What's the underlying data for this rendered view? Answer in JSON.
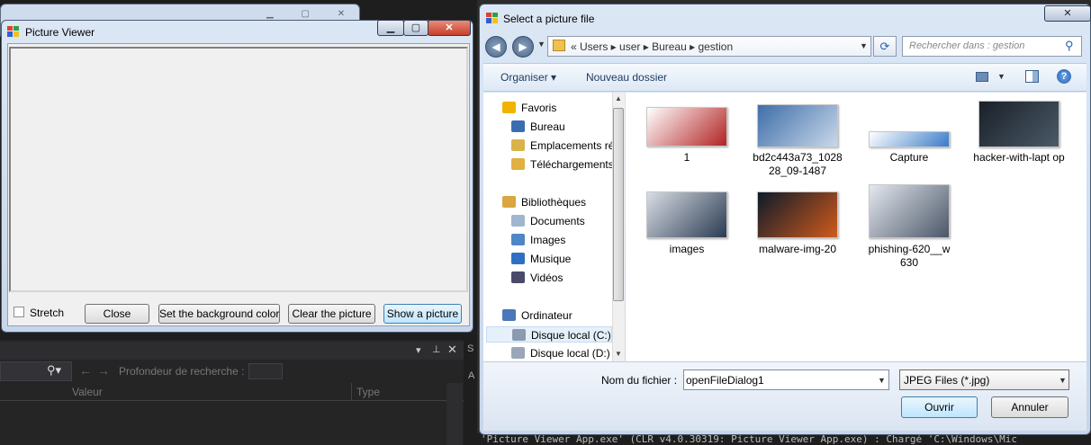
{
  "ide": {
    "depth_label": "Profondeur de recherche :",
    "col_valeur": "Valeur",
    "col_type": "Type",
    "side_tab_s": "S",
    "side_tab_a": "A",
    "output_line": "'Picture Viewer App.exe' (CLR v4.0.30319: Picture Viewer App.exe) : Chargé 'C:\\Windows\\Mic"
  },
  "picture_viewer": {
    "title": "Picture Viewer",
    "stretch_label": "Stretch",
    "stretch_checked": false,
    "buttons": {
      "close": "Close",
      "background": "Set the background color",
      "clear": "Clear the picture",
      "show": "Show a picture"
    }
  },
  "dialog": {
    "title": "Select a picture file",
    "address_path": "«  Users  ▸  user  ▸  Bureau  ▸  gestion",
    "search_placeholder": "Rechercher dans : gestion",
    "toolbar": {
      "organize": "Organiser ▾",
      "new_folder": "Nouveau dossier"
    },
    "nav_items": [
      {
        "label": "Favoris",
        "icon": "star-icon",
        "color": "#f0b400"
      },
      {
        "label": "Bureau",
        "icon": "desktop-icon",
        "color": "#3a6db0"
      },
      {
        "label": "Emplacements ré",
        "icon": "recent-places-icon",
        "color": "#d9b24a"
      },
      {
        "label": "Téléchargements",
        "icon": "downloads-icon",
        "color": "#e0b040"
      },
      {
        "label": "Bibliothèques",
        "icon": "libraries-icon",
        "color": "#d9a640"
      },
      {
        "label": "Documents",
        "icon": "documents-icon",
        "color": "#9fb5d0"
      },
      {
        "label": "Images",
        "icon": "images-icon",
        "color": "#4f86c6"
      },
      {
        "label": "Musique",
        "icon": "music-icon",
        "color": "#2e6fc4"
      },
      {
        "label": "Vidéos",
        "icon": "videos-icon",
        "color": "#4a4a6a"
      },
      {
        "label": "Ordinateur",
        "icon": "computer-icon",
        "color": "#4a78b8"
      },
      {
        "label": "Disque local (C:)",
        "icon": "drive-icon",
        "color": "#8a9bb0"
      },
      {
        "label": "Disque local (D:)",
        "icon": "drive-icon",
        "color": "#9aa7b7"
      }
    ],
    "files": [
      {
        "label": "1",
        "colors": [
          "#ffffff",
          "#b22222"
        ]
      },
      {
        "label": "bd2c443a73_1028 28_09-1487",
        "colors": [
          "#3e6ea8",
          "#c9d8ea"
        ]
      },
      {
        "label": "Capture",
        "colors": [
          "#ffffff",
          "#3a7bc8"
        ]
      },
      {
        "label": "hacker-with-lapt op",
        "colors": [
          "#1a2028",
          "#4a5a68"
        ]
      },
      {
        "label": "images",
        "colors": [
          "#d8dde4",
          "#2a3b52"
        ]
      },
      {
        "label": "malware-img-20",
        "colors": [
          "#0d1a2a",
          "#d05a1a"
        ]
      },
      {
        "label": "phishing-620__w 630",
        "colors": [
          "#e4e8ee",
          "#4a5668"
        ]
      }
    ],
    "filename_label": "Nom du fichier :",
    "filename_value": "openFileDialog1",
    "filter_value": "JPEG Files (*.jpg)",
    "open_button": "Ouvrir",
    "cancel_button": "Annuler"
  }
}
